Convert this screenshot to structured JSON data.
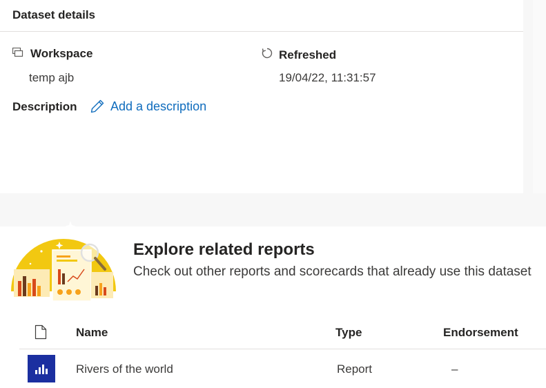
{
  "details": {
    "title": "Dataset details",
    "workspace_label": "Workspace",
    "workspace_value": "temp ajb",
    "refreshed_label": "Refreshed",
    "refreshed_value": "19/04/22, 11:31:57",
    "description_label": "Description",
    "add_description_link": "Add a description"
  },
  "explore": {
    "title": "Explore related reports",
    "subtitle": "Check out other reports and scorecards that already use this dataset"
  },
  "table": {
    "columns": {
      "name": "Name",
      "type": "Type",
      "endorsement": "Endorsement"
    },
    "rows": [
      {
        "name": "Rivers of the world",
        "type": "Report",
        "endorsement": "–"
      }
    ]
  },
  "colors": {
    "accent_link": "#0f6cbd",
    "report_tile": "#1b2fa0",
    "illustration_sun": "#f2c811"
  },
  "icons": {
    "workspace": "workspace-icon",
    "refreshed": "refresh-icon",
    "add_description": "pencil-icon",
    "doc_column": "document-icon",
    "report": "report-bar-chart-icon"
  }
}
